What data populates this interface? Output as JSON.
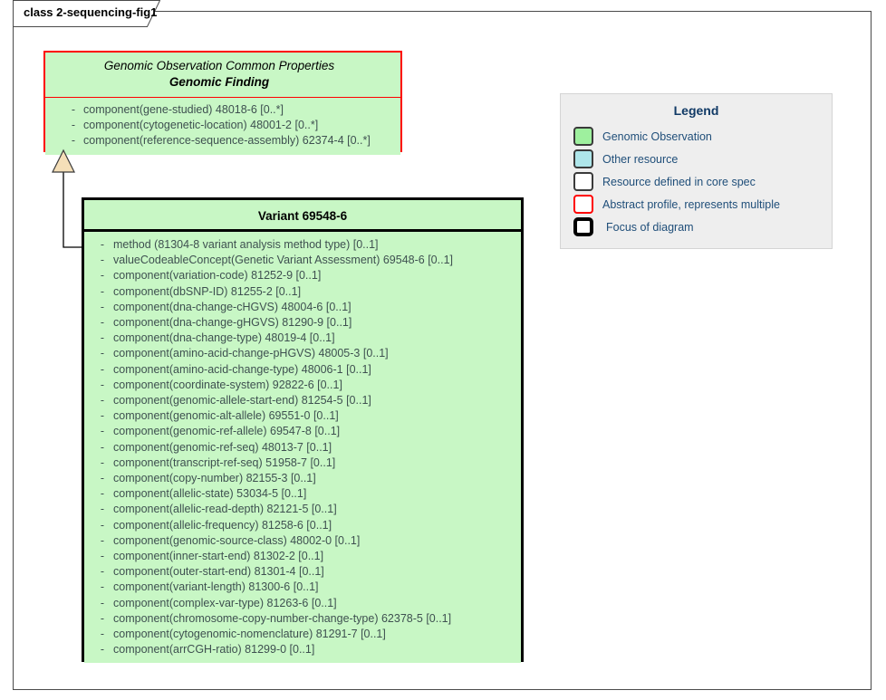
{
  "diagram": {
    "tab_label": "class 2-sequencing-fig1",
    "colors": {
      "class_fill": "#c8f7c5",
      "abstract_border": "#ff0000",
      "focus_border": "#000000",
      "attr_text": "#3e5050",
      "legend_text": "#1f4e79",
      "legend_title": "#113a66",
      "legend_bg": "#eeeeee",
      "arrowhead_fill": "#f5dfb8"
    }
  },
  "parent_class": {
    "stereotype": "Genomic Observation Common Properties",
    "name": "Genomic Finding",
    "attributes": [
      {
        "visibility": "-",
        "text": "component(gene-studied) 48018-6 [0..*]"
      },
      {
        "visibility": "-",
        "text": "component(cytogenetic-location) 48001-2 [0..*]"
      },
      {
        "visibility": "-",
        "text": "component(reference-sequence-assembly) 62374-4 [0..*]"
      }
    ]
  },
  "variant_class": {
    "name": "Variant 69548-6",
    "attributes": [
      {
        "visibility": "-",
        "text": "method (81304-8 variant analysis method type) [0..1]"
      },
      {
        "visibility": "-",
        "text": "valueCodeableConcept(Genetic Variant Assessment) 69548-6 [0..1]"
      },
      {
        "visibility": "-",
        "text": "component(variation-code) 81252-9 [0..1]"
      },
      {
        "visibility": "-",
        "text": "component(dbSNP-ID) 81255-2 [0..1]"
      },
      {
        "visibility": "-",
        "text": "component(dna-change-cHGVS) 48004-6 [0..1]"
      },
      {
        "visibility": "-",
        "text": "component(dna-change-gHGVS) 81290-9 [0..1]"
      },
      {
        "visibility": "-",
        "text": "component(dna-change-type) 48019-4 [0..1]"
      },
      {
        "visibility": "-",
        "text": "component(amino-acid-change-pHGVS) 48005-3 [0..1]"
      },
      {
        "visibility": "-",
        "text": "component(amino-acid-change-type) 48006-1 [0..1]"
      },
      {
        "visibility": "-",
        "text": "component(coordinate-system) 92822-6 [0..1]"
      },
      {
        "visibility": "-",
        "text": "component(genomic-allele-start-end) 81254-5 [0..1]"
      },
      {
        "visibility": "-",
        "text": "component(genomic-alt-allele) 69551-0 [0..1]"
      },
      {
        "visibility": "-",
        "text": "component(genomic-ref-allele) 69547-8 [0..1]"
      },
      {
        "visibility": "-",
        "text": "component(genomic-ref-seq) 48013-7 [0..1]"
      },
      {
        "visibility": "-",
        "text": "component(transcript-ref-seq) 51958-7 [0..1]"
      },
      {
        "visibility": "-",
        "text": "component(copy-number) 82155-3 [0..1]"
      },
      {
        "visibility": "-",
        "text": "component(allelic-state) 53034-5 [0..1]"
      },
      {
        "visibility": "-",
        "text": "component(allelic-read-depth) 82121-5 [0..1]"
      },
      {
        "visibility": "-",
        "text": "component(allelic-frequency) 81258-6 [0..1]"
      },
      {
        "visibility": "-",
        "text": "component(genomic-source-class) 48002-0 [0..1]"
      },
      {
        "visibility": "-",
        "text": "component(inner-start-end) 81302-2 [0..1]"
      },
      {
        "visibility": "-",
        "text": "component(outer-start-end) 81301-4 [0..1]"
      },
      {
        "visibility": "-",
        "text": "component(variant-length) 81300-6 [0..1]"
      },
      {
        "visibility": "-",
        "text": "component(complex-var-type) 81263-6 [0..1]"
      },
      {
        "visibility": "-",
        "text": "component(chromosome-copy-number-change-type) 62378-5 [0..1]"
      },
      {
        "visibility": "-",
        "text": "component(cytogenomic-nomenclature) 81291-7 [0..1]"
      },
      {
        "visibility": "-",
        "text": "component(arrCGH-ratio) 81299-0 [0..1]"
      }
    ]
  },
  "legend": {
    "title": "Legend",
    "items": [
      {
        "label": "Genomic Observation",
        "swatch": "green-fill-swatch"
      },
      {
        "label": "Other resource",
        "swatch": "blue-fill-swatch"
      },
      {
        "label": "Resource defined in core spec",
        "swatch": "white-fill-swatch"
      },
      {
        "label": "Abstract profile, represents multiple",
        "swatch": "red-outline-swatch"
      },
      {
        "label": "Focus of diagram",
        "swatch": "thick-black-outline-swatch"
      }
    ]
  }
}
